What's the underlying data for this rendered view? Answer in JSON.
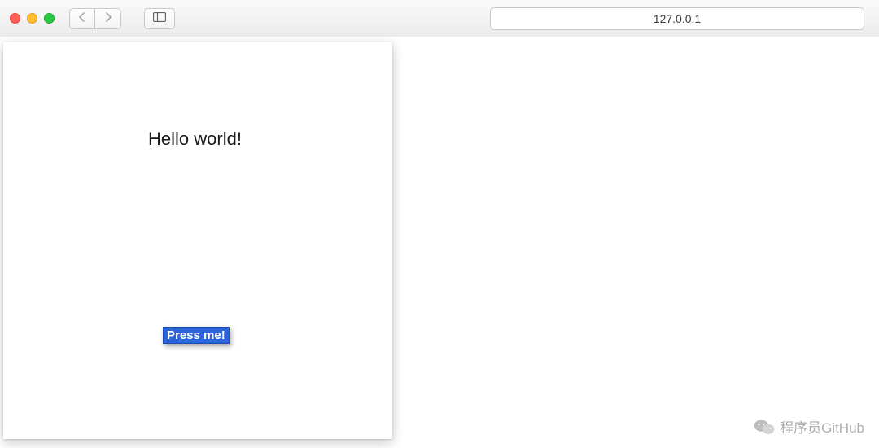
{
  "browser": {
    "address": "127.0.0.1"
  },
  "page": {
    "heading": "Hello world!",
    "button_label": "Press me!"
  },
  "watermark": {
    "text": "程序员GitHub"
  }
}
